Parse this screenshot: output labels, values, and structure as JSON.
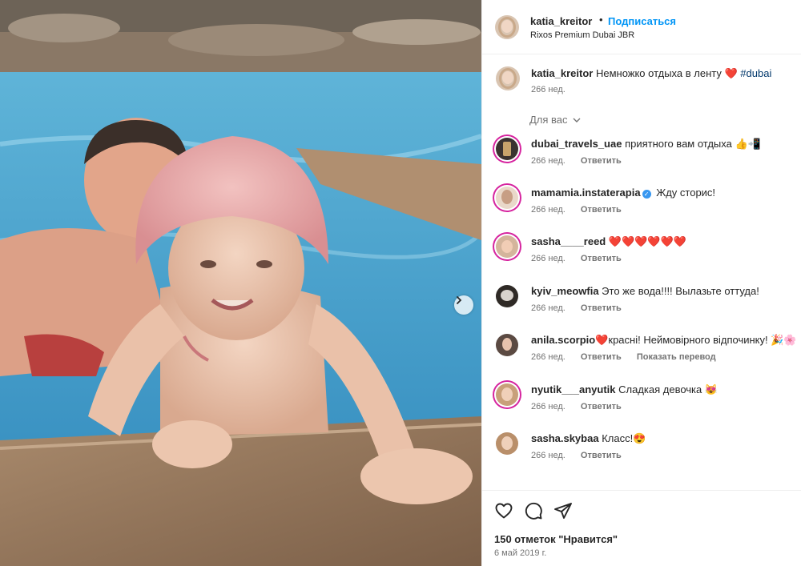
{
  "post": {
    "username": "katia_kreitor",
    "dot": "•",
    "follow_label": "Подписаться",
    "location": "Rixos Premium Dubai JBR",
    "caption_text": "Немножко отдыха в ленту",
    "caption_emoji": "❤️",
    "hashtag": "#dubai",
    "caption_age": "266 нед.",
    "for_you_label": "Для вас",
    "likes": "150 отметок \"Нравится\"",
    "date": "6 май 2019 г."
  },
  "comments": [
    {
      "user": "dubai_travels_uae",
      "text": "приятного вам отдыха 👍📲",
      "age": "266 нед.",
      "reply": "Ответить"
    },
    {
      "user": "mamamia.instaterapia",
      "text": "Жду сторис!",
      "age": "266 нед.",
      "reply": "Ответить"
    },
    {
      "user": "sasha____reed",
      "text": "❤️❤️❤️❤️❤️❤️",
      "age": "266 нед.",
      "reply": "Ответить"
    },
    {
      "user": "kyiv_meowfia",
      "text": "Это же вода!!!! Вылазьте оттуда!",
      "age": "266 нед.",
      "reply": "Ответить"
    },
    {
      "user": "anila.scorpio",
      "text": "❤️красні! Неймовірного відпочинку! 🎉🌸",
      "age": "266 нед.",
      "reply": "Ответить",
      "translate": "Показать перевод"
    },
    {
      "user": "nyutik___anyutik",
      "text": "Сладкая девочка 😻",
      "age": "266 нед.",
      "reply": "Ответить"
    },
    {
      "user": "sasha.skybaa",
      "text": "Класс!😍",
      "age": "266 нед.",
      "reply": "Ответить"
    }
  ],
  "icons": [
    "heart-icon",
    "comment-icon",
    "share-icon",
    "chevron-right-icon",
    "chevron-down-icon",
    "verified-icon"
  ],
  "colors": {
    "link": "#0095f6",
    "hashtag": "#00376b",
    "muted": "#737373",
    "ring": "#d6249f",
    "pool": "#6fb6d6"
  }
}
